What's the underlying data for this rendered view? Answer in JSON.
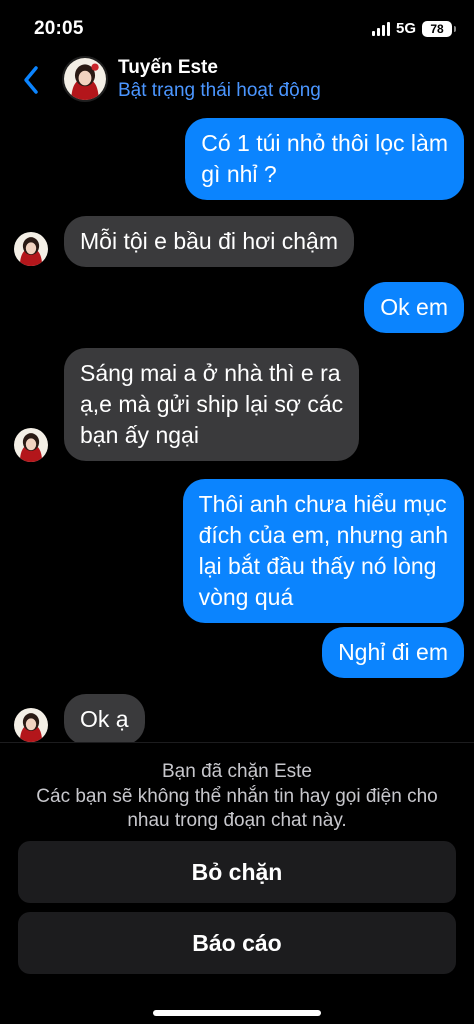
{
  "status_bar": {
    "time": "20:05",
    "network": "5G",
    "battery": "78"
  },
  "header": {
    "name": "Tuyến Este",
    "subtitle": "Bật trạng thái hoạt động"
  },
  "messages": [
    {
      "from": "me",
      "text": "Có 1 túi nhỏ thôi lọc làm\ngì nhỉ ?"
    },
    {
      "from": "them",
      "text": "Mỗi tội e bầu đi hơi chậm"
    },
    {
      "from": "me",
      "text": "Ok em"
    },
    {
      "from": "them",
      "text": "Sáng mai a ở nhà thì e ra\nạ,e mà gửi ship lại sợ các\nbạn ấy ngại"
    },
    {
      "from": "me",
      "text": "Thôi anh chưa hiểu mục\nđích của em, nhưng anh\nlại bắt đầu thấy nó lòng\nvòng quá"
    },
    {
      "from": "me",
      "text": "Nghỉ đi em"
    },
    {
      "from": "them",
      "text": "Ok ạ"
    }
  ],
  "blocked_panel": {
    "title": "Bạn đã chặn Este",
    "description": "Các bạn sẽ không thể nhắn tin hay gọi điện cho nhau trong đoạn chat này.",
    "unblock_label": "Bỏ chặn",
    "report_label": "Báo cáo"
  },
  "colors": {
    "outgoing": "#0b84fe",
    "incoming": "#3a3a3c",
    "link": "#4b96ff",
    "background": "#000000"
  },
  "icons": {
    "back": "chevron-left-icon",
    "signal": "signal-bars-icon",
    "battery": "battery-icon"
  }
}
